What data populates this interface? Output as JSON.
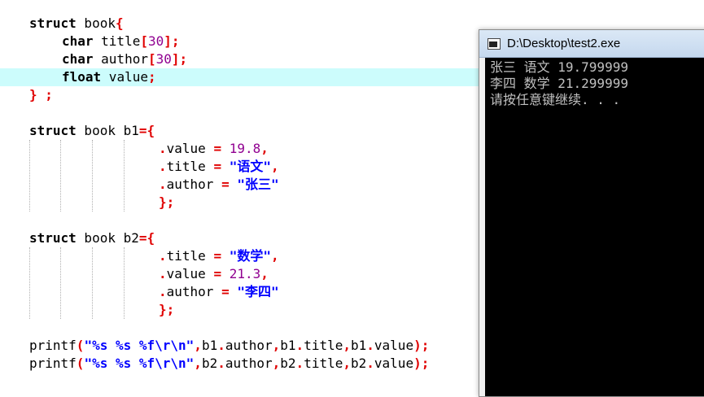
{
  "editor": {
    "lines": [
      [
        "struct",
        " book",
        "{"
      ],
      [
        "char",
        " title",
        "[",
        "30",
        "];"
      ],
      [
        "char",
        " author",
        "[",
        "30",
        "];"
      ],
      [
        "float",
        " value",
        ";"
      ],
      [
        "} ;"
      ],
      [
        "struct",
        " book b1",
        "={"
      ],
      [
        ".",
        "value",
        " = ",
        "19.8",
        ","
      ],
      [
        ".",
        "title",
        " = ",
        "\"语文\"",
        ","
      ],
      [
        ".",
        "author",
        " = ",
        "\"张三\""
      ],
      [
        "};"
      ],
      [
        "struct",
        " book b2",
        "={"
      ],
      [
        ".",
        "title",
        " = ",
        "\"数学\"",
        ","
      ],
      [
        ".",
        "value",
        " = ",
        "21.3",
        ","
      ],
      [
        ".",
        "author",
        " = ",
        "\"李四\""
      ],
      [
        "};"
      ],
      [
        "printf",
        "(",
        "\"%s %s %f\\r\\n\"",
        ",",
        "b1",
        ".",
        "author",
        ",",
        "b1",
        ".",
        "title",
        ",",
        "b1",
        ".",
        "value",
        ");"
      ],
      [
        "printf",
        "(",
        "\"%s %s %f\\r\\n\"",
        ",",
        "b2",
        ".",
        "author",
        ",",
        "b2",
        ".",
        "title",
        ",",
        "b2",
        ".",
        "value",
        ");"
      ]
    ]
  },
  "console": {
    "title": "D:\\Desktop\\test2.exe",
    "output": [
      "张三 语文 19.799999",
      "李四 数学 21.299999",
      "请按任意键继续. . ."
    ]
  }
}
